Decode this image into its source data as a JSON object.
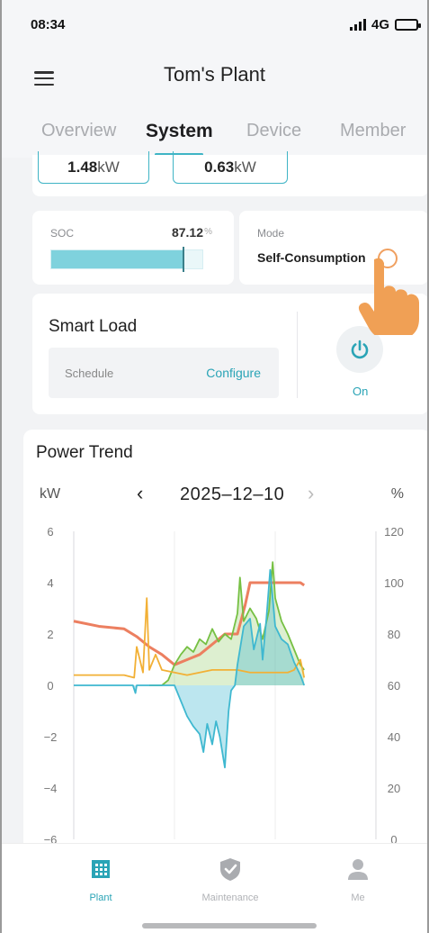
{
  "status_bar": {
    "time": "08:34",
    "network": "4G"
  },
  "header": {
    "title": "Tom's Plant"
  },
  "tabs": [
    {
      "label": "Overview"
    },
    {
      "label": "System"
    },
    {
      "label": "Device"
    },
    {
      "label": "Member"
    }
  ],
  "active_tab": "System",
  "power_values": [
    {
      "value": "1.48",
      "unit": "kW"
    },
    {
      "value": "0.63",
      "unit": " kW"
    }
  ],
  "soc": {
    "label": "SOC",
    "value": "87.12",
    "unit": "%",
    "level_percent": 87.12
  },
  "mode": {
    "label": "Mode",
    "value": "Self-Consumption"
  },
  "smart_load": {
    "title": "Smart Load",
    "schedule_label": "Schedule",
    "configure_label": "Configure",
    "state_label": "On"
  },
  "power_trend": {
    "title": "Power Trend",
    "left_unit": "kW",
    "right_unit": "%",
    "date": "2025–12–10"
  },
  "chart_data": {
    "type": "line",
    "title": "Power Trend",
    "x_range_hours": [
      0,
      24
    ],
    "y_left": {
      "label": "kW",
      "ticks": [
        6,
        4,
        2,
        0,
        -2,
        -4,
        -6
      ],
      "range": [
        -6,
        6
      ]
    },
    "y_right": {
      "label": "%",
      "ticks": [
        120,
        100,
        80,
        60,
        40,
        20,
        0
      ],
      "range": [
        0,
        120
      ]
    },
    "grid": "vertical lines at 8 and 16 hours",
    "series": [
      {
        "axis": "right",
        "color": "#ec7f60",
        "points": [
          [
            0,
            85
          ],
          [
            2,
            83
          ],
          [
            4,
            82
          ],
          [
            5,
            79
          ],
          [
            6,
            75
          ],
          [
            7,
            72
          ],
          [
            8,
            68
          ],
          [
            9,
            70
          ],
          [
            10,
            72
          ],
          [
            11,
            76
          ],
          [
            12,
            80
          ],
          [
            13,
            80
          ],
          [
            13.6,
            91
          ],
          [
            14,
            100
          ],
          [
            15,
            100
          ],
          [
            16,
            100
          ],
          [
            17,
            100
          ],
          [
            18,
            100
          ],
          [
            18.3,
            99
          ]
        ]
      },
      {
        "axis": "left",
        "color": "#76c043",
        "points": [
          [
            6,
            0
          ],
          [
            7,
            0
          ],
          [
            7.5,
            0.2
          ],
          [
            8,
            0.8
          ],
          [
            8.5,
            1.2
          ],
          [
            9,
            1.5
          ],
          [
            9.5,
            1.3
          ],
          [
            10,
            1.8
          ],
          [
            10.5,
            1.6
          ],
          [
            11,
            2.2
          ],
          [
            11.5,
            1.7
          ],
          [
            12,
            2.0
          ],
          [
            12.5,
            1.8
          ],
          [
            13,
            2.8
          ],
          [
            13.2,
            4.2
          ],
          [
            13.5,
            2.5
          ],
          [
            14,
            3.0
          ],
          [
            14.5,
            2.6
          ],
          [
            15,
            1.8
          ],
          [
            15.5,
            2.9
          ],
          [
            15.8,
            4.8
          ],
          [
            16,
            3.4
          ],
          [
            16.5,
            2.5
          ],
          [
            17,
            2.0
          ],
          [
            17.5,
            1.4
          ],
          [
            18,
            0.8
          ],
          [
            18.3,
            0.6
          ]
        ]
      },
      {
        "axis": "left",
        "color": "#f2b035",
        "points": [
          [
            0,
            0.4
          ],
          [
            1,
            0.4
          ],
          [
            2,
            0.4
          ],
          [
            3,
            0.4
          ],
          [
            4,
            0.4
          ],
          [
            4.8,
            0.3
          ],
          [
            5,
            1.5
          ],
          [
            5.5,
            0.5
          ],
          [
            5.8,
            3.4
          ],
          [
            6,
            0.6
          ],
          [
            6.5,
            1.2
          ],
          [
            7,
            0.6
          ],
          [
            8,
            0.5
          ],
          [
            9,
            0.4
          ],
          [
            10,
            0.5
          ],
          [
            11,
            0.6
          ],
          [
            12,
            0.6
          ],
          [
            13,
            0.6
          ],
          [
            14,
            0.5
          ],
          [
            15,
            0.5
          ],
          [
            16,
            0.5
          ],
          [
            17,
            0.5
          ],
          [
            17.5,
            0.6
          ],
          [
            18,
            1.0
          ],
          [
            18.3,
            0.3
          ]
        ]
      },
      {
        "axis": "left",
        "color": "#3fb8d0",
        "points": [
          [
            0,
            0
          ],
          [
            4.7,
            0
          ],
          [
            4.9,
            -0.3
          ],
          [
            5,
            0
          ],
          [
            8,
            0
          ],
          [
            8.5,
            -0.6
          ],
          [
            9,
            -1.2
          ],
          [
            9.5,
            -1.6
          ],
          [
            10,
            -1.9
          ],
          [
            10.3,
            -2.6
          ],
          [
            10.6,
            -1.5
          ],
          [
            11,
            -2.3
          ],
          [
            11.3,
            -1.4
          ],
          [
            11.6,
            -2.0
          ],
          [
            12,
            -3.2
          ],
          [
            12.3,
            -1.0
          ],
          [
            12.5,
            -0.2
          ],
          [
            12.8,
            0
          ],
          [
            13,
            0.8
          ],
          [
            13.5,
            2.3
          ],
          [
            14,
            2.6
          ],
          [
            14.3,
            1.4
          ],
          [
            14.8,
            2.4
          ],
          [
            15,
            1.0
          ],
          [
            15.3,
            2.6
          ],
          [
            15.6,
            4.5
          ],
          [
            16,
            2.3
          ],
          [
            16.5,
            1.8
          ],
          [
            17,
            1.6
          ],
          [
            17.5,
            0.9
          ],
          [
            18,
            0.4
          ],
          [
            18.3,
            0
          ]
        ]
      }
    ]
  },
  "bottom_nav": [
    {
      "label": "Plant",
      "icon": "plant-building-icon",
      "active": true
    },
    {
      "label": "Maintenance",
      "icon": "shield-check-icon",
      "active": false
    },
    {
      "label": "Me",
      "icon": "person-icon",
      "active": false
    }
  ],
  "colors": {
    "accent": "#3fb4c5",
    "solar": "#76c043",
    "load": "#f2b035",
    "grid": "#3fb8d0",
    "soc": "#ec7f60"
  }
}
